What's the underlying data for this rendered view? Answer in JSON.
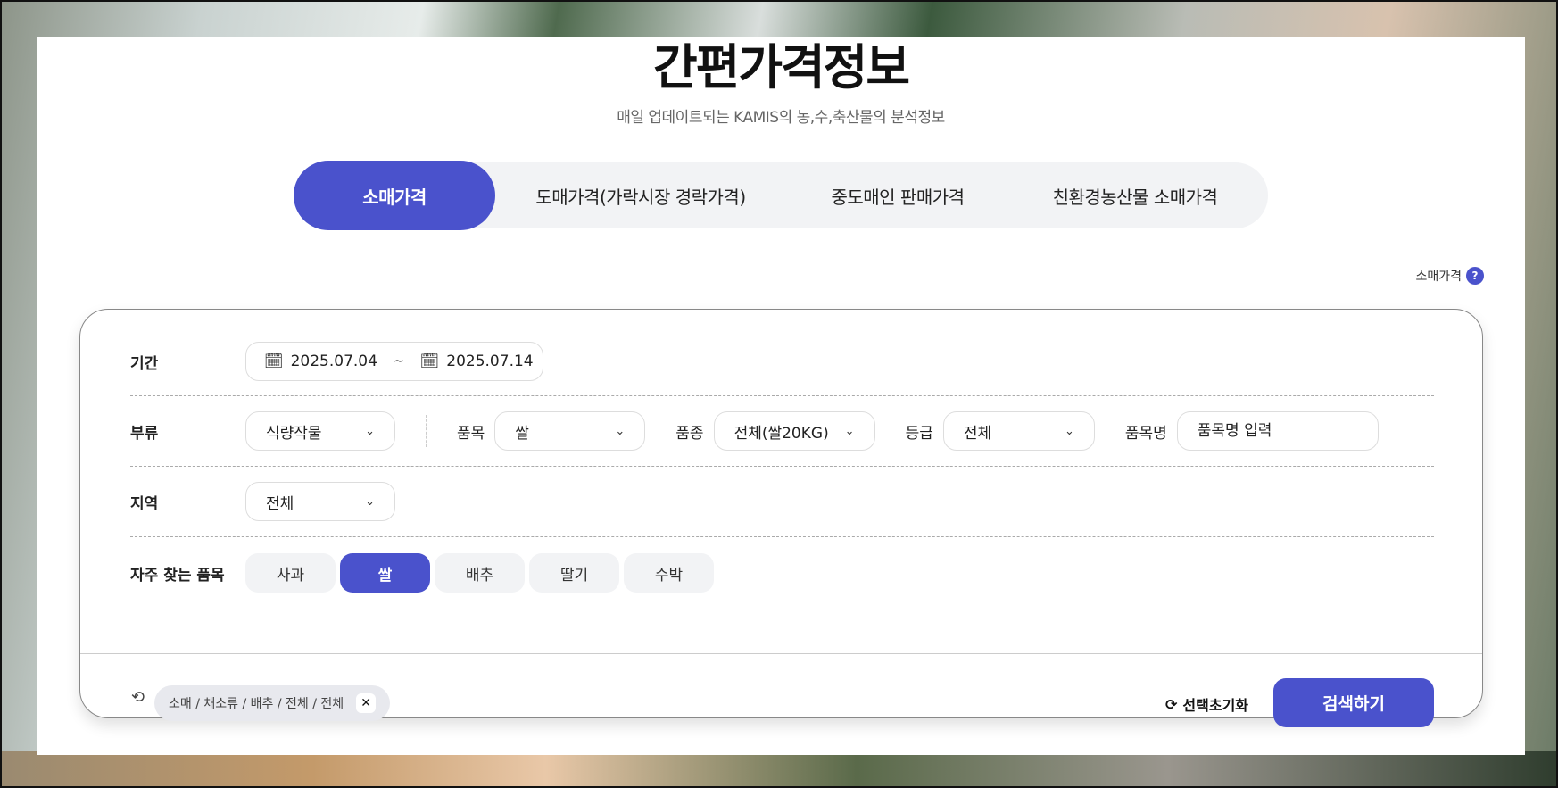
{
  "header": {
    "title": "간편가격정보",
    "subtitle": "매일 업데이트되는 KAMIS의 농,수,축산물의 분석정보"
  },
  "tabs": [
    {
      "label": "소매가격",
      "active": true
    },
    {
      "label": "도매가격(가락시장 경락가격)"
    },
    {
      "label": "중도매인 판매가격"
    },
    {
      "label": "친환경농산물 소매가격"
    }
  ],
  "help": {
    "label": "소매가격",
    "icon": "?"
  },
  "form": {
    "period": {
      "label": "기간",
      "start": "2025.07.04",
      "sep": "~",
      "end": "2025.07.14"
    },
    "category": {
      "label": "부류",
      "value": "식량작물"
    },
    "item": {
      "label": "품목",
      "value": "쌀"
    },
    "variety": {
      "label": "품종",
      "value": "전체(쌀20KG)"
    },
    "grade": {
      "label": "등급",
      "value": "전체"
    },
    "item_name": {
      "label": "품목명",
      "placeholder": "품목명 입력"
    },
    "region": {
      "label": "지역",
      "value": "전체"
    },
    "frequent": {
      "label": "자주 찾는 품목",
      "chips": [
        {
          "label": "사과"
        },
        {
          "label": "쌀",
          "active": true
        },
        {
          "label": "배추"
        },
        {
          "label": "딸기"
        },
        {
          "label": "수박"
        }
      ]
    }
  },
  "footer": {
    "history": "소매 / 채소류 / 배추 / 전체 / 전체",
    "history_close": "✕",
    "reset": "선택초기화",
    "search": "검색하기"
  },
  "colors": {
    "accent": "#4a52cc"
  }
}
